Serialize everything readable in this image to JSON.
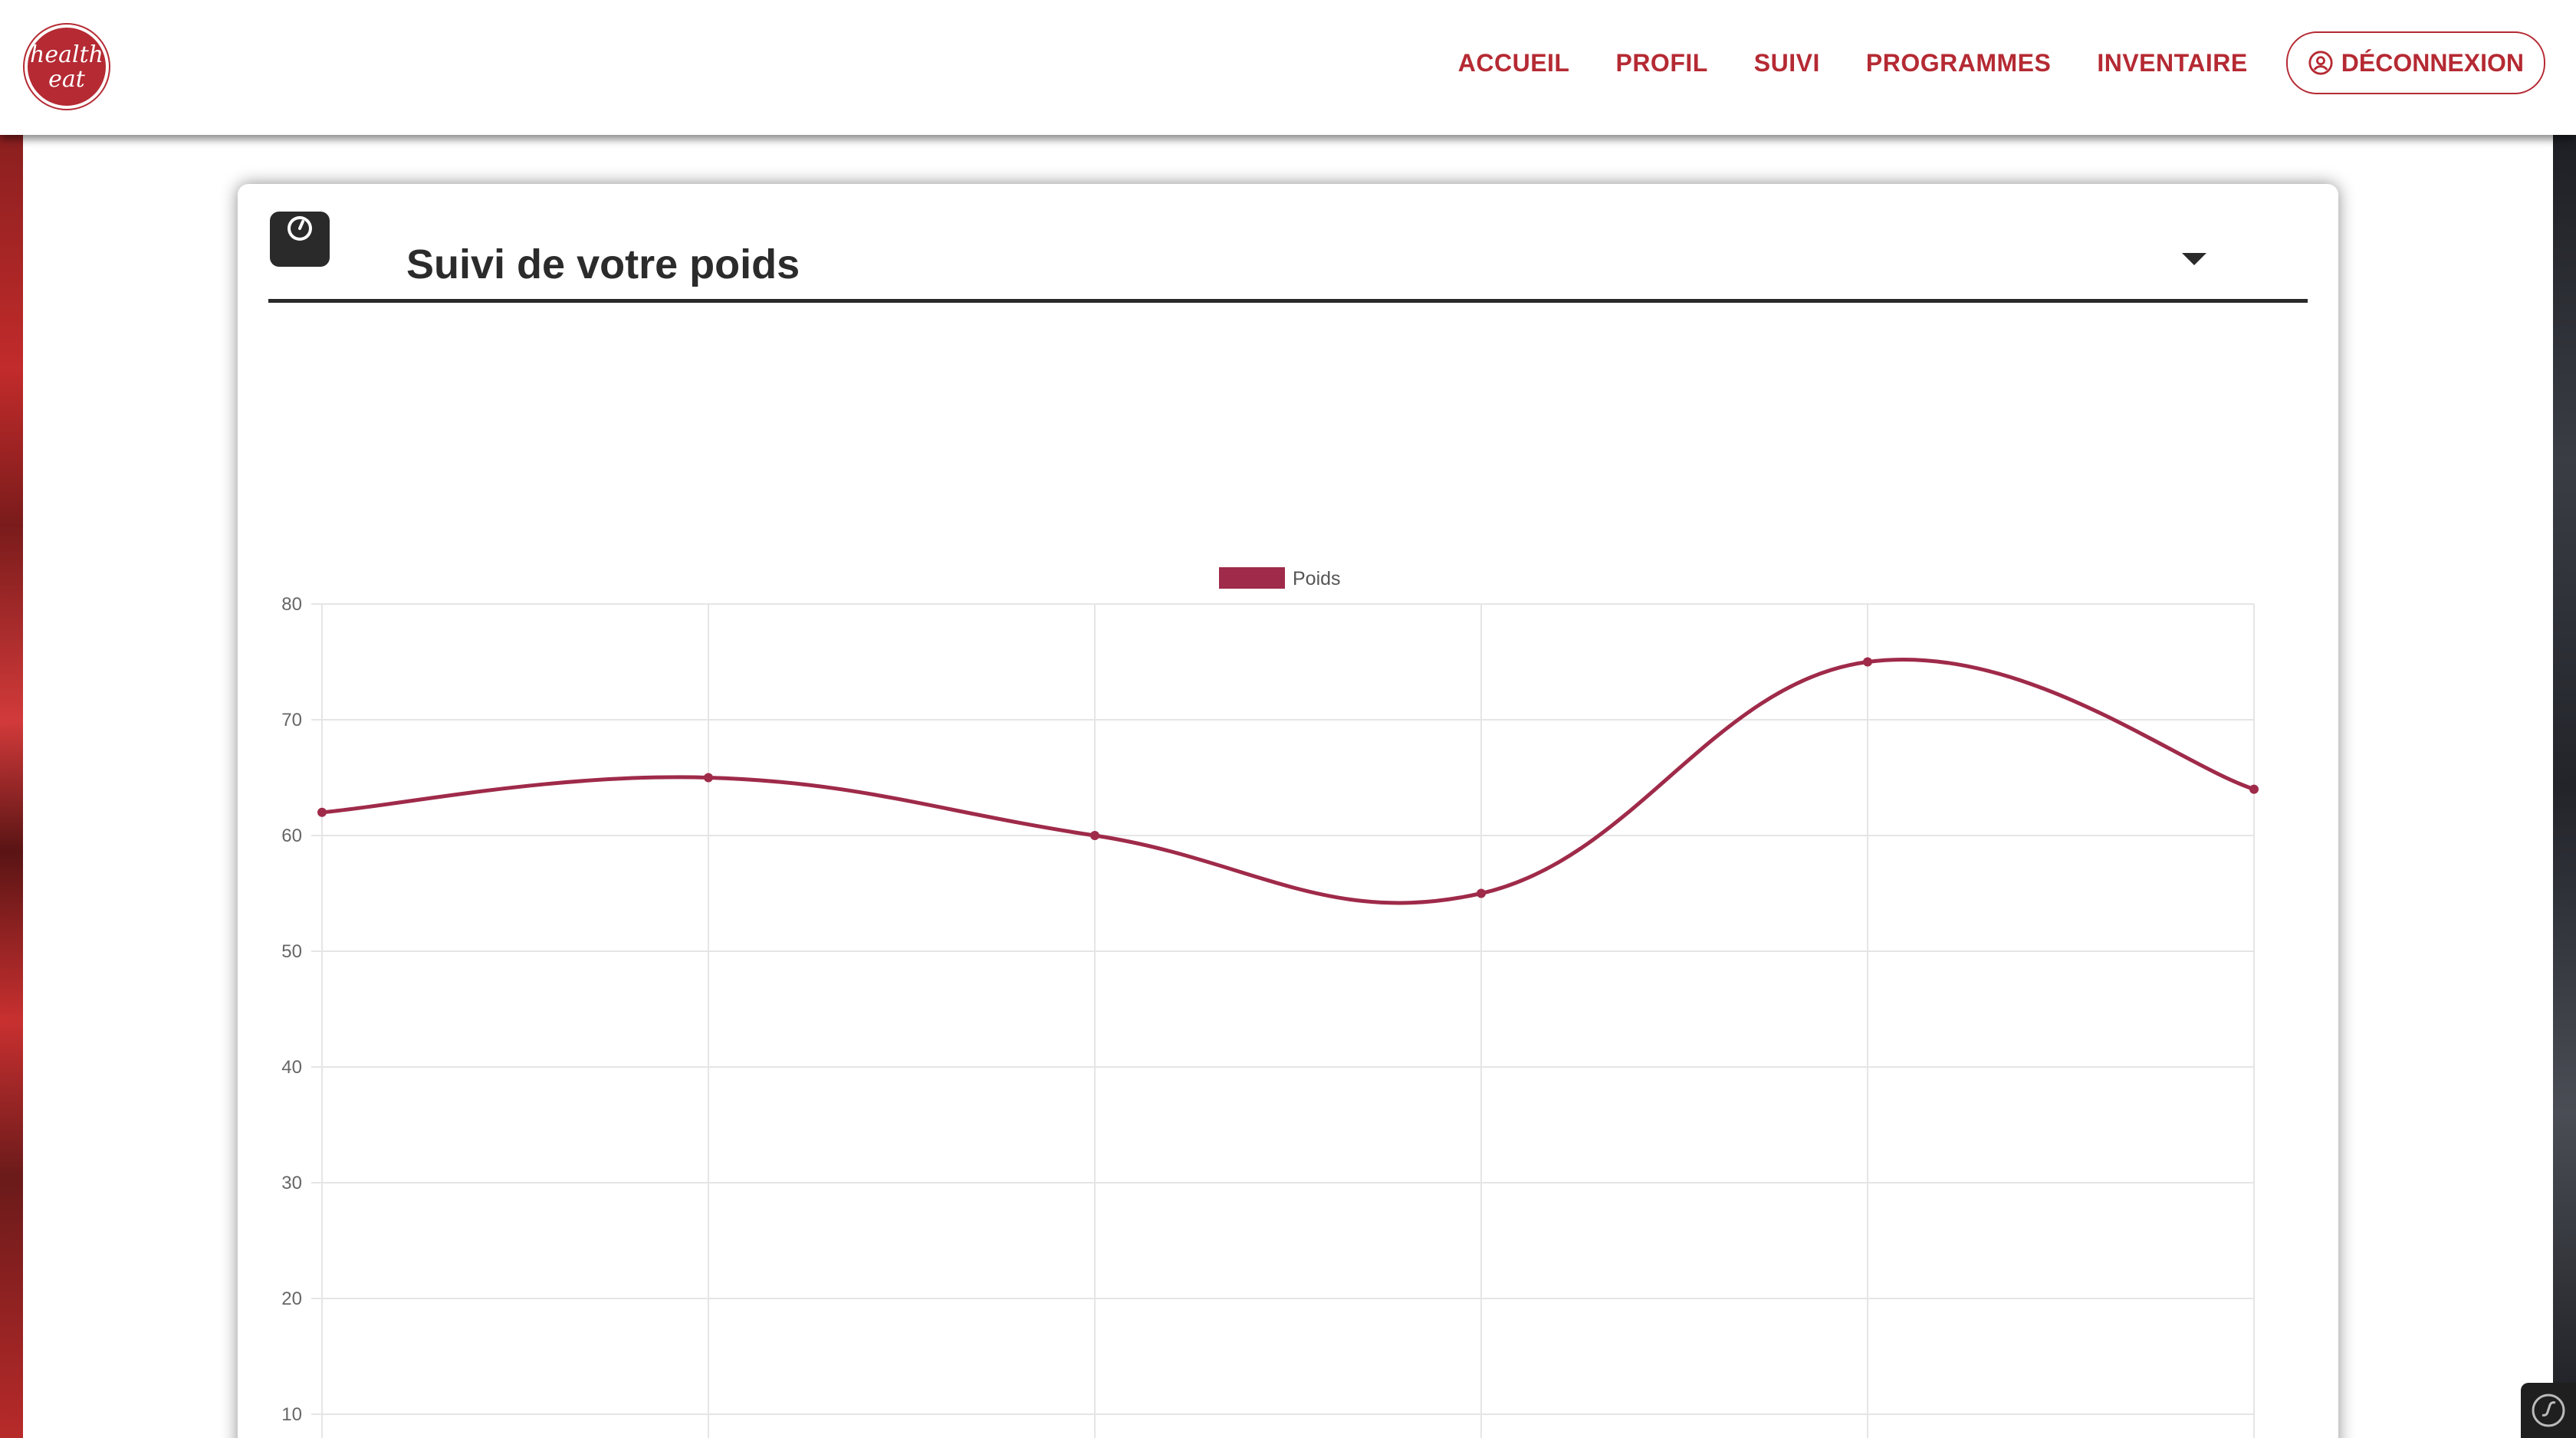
{
  "header": {
    "logo": {
      "line1": "health",
      "line2": "eat"
    },
    "nav": [
      {
        "label": "ACCUEIL"
      },
      {
        "label": "PROFIL"
      },
      {
        "label": "SUIVI"
      },
      {
        "label": "PROGRAMMES"
      },
      {
        "label": "INVENTAIRE"
      }
    ],
    "logout_label": "DÉCONNEXION"
  },
  "card": {
    "title": "Suivi de votre poids",
    "icon": "scale-icon",
    "toggle_icon": "caret-down-icon"
  },
  "colors": {
    "brand": "#b52a33",
    "series": "#9f2a49",
    "grid": "#e5e5e5"
  },
  "chart_data": {
    "type": "line",
    "smooth": true,
    "series": [
      {
        "name": "Poids",
        "values": [
          62,
          65,
          60,
          55,
          75,
          64
        ]
      }
    ],
    "y_ticks": [
      10,
      20,
      30,
      40,
      50,
      60,
      70,
      80
    ],
    "ylim": [
      0,
      80
    ],
    "grid": true,
    "legend": "top-center"
  }
}
